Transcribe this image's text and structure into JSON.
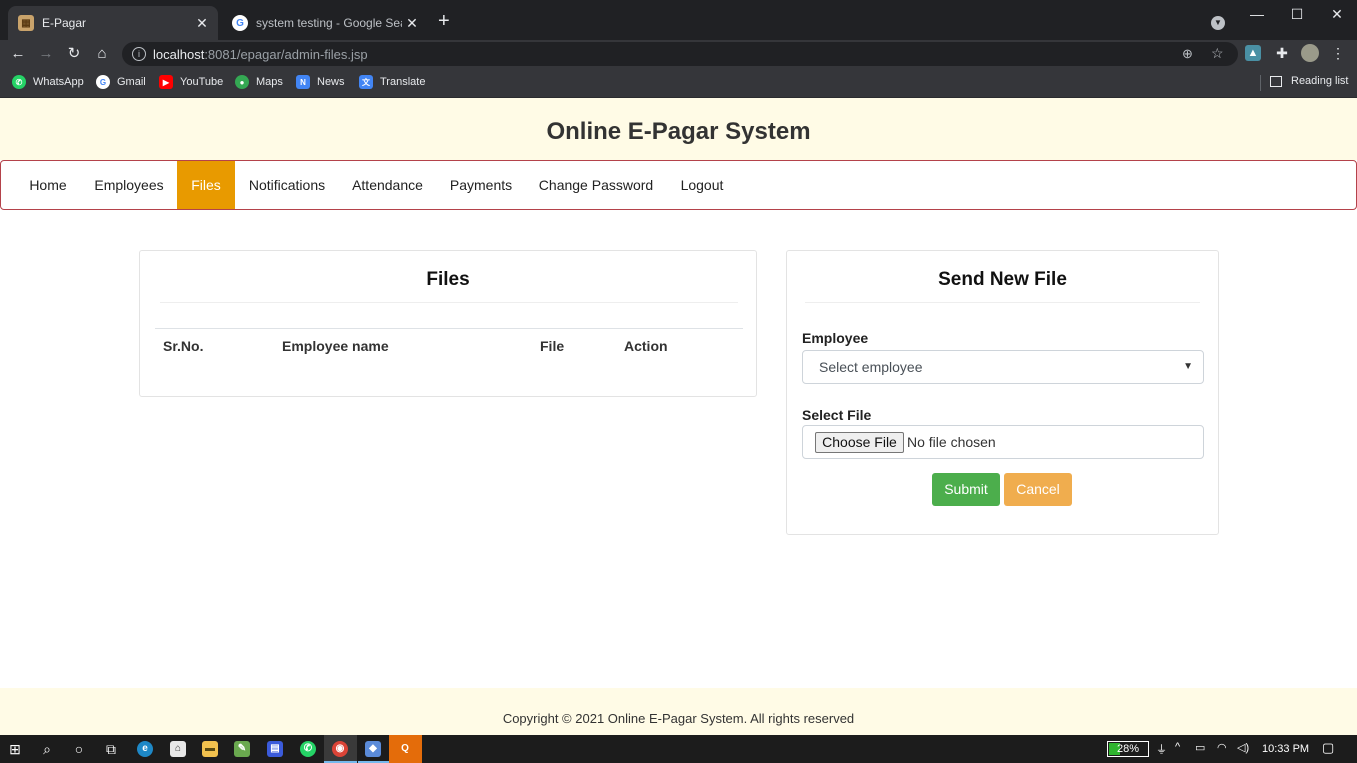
{
  "browser": {
    "tabs": [
      {
        "title": "E-Pagar",
        "active": true
      },
      {
        "title": "system testing - Google Search",
        "active": false
      }
    ],
    "url": {
      "host": "localhost",
      "path": ":8081/epagar/admin-files.jsp"
    },
    "bookmarks": [
      {
        "label": "WhatsApp",
        "icon": "whatsapp-icon",
        "color": "#25d366"
      },
      {
        "label": "Gmail",
        "icon": "google-icon",
        "color": "#ffffff"
      },
      {
        "label": "YouTube",
        "icon": "youtube-icon",
        "color": "#ff0000"
      },
      {
        "label": "Maps",
        "icon": "maps-icon",
        "color": "#34a853"
      },
      {
        "label": "News",
        "icon": "news-icon",
        "color": "#4285f4"
      },
      {
        "label": "Translate",
        "icon": "translate-icon",
        "color": "#4285f4"
      }
    ],
    "reading_list": "Reading list"
  },
  "site": {
    "title": "Online E-Pagar System",
    "nav": [
      {
        "label": "Home",
        "active": false
      },
      {
        "label": "Employees",
        "active": false
      },
      {
        "label": "Files",
        "active": true
      },
      {
        "label": "Notifications",
        "active": false
      },
      {
        "label": "Attendance",
        "active": false
      },
      {
        "label": "Payments",
        "active": false
      },
      {
        "label": "Change Password",
        "active": false
      },
      {
        "label": "Logout",
        "active": false
      }
    ],
    "accent_color": "#e89a00",
    "header_bg": "#fffbe6"
  },
  "files_card": {
    "title": "Files",
    "columns": [
      "Sr.No.",
      "Employee name",
      "File",
      "Action"
    ],
    "rows": []
  },
  "send_card": {
    "title": "Send New File",
    "employee_label": "Employee",
    "employee_select": "Select employee",
    "file_label": "Select File",
    "choose_button": "Choose File",
    "no_file": "No file chosen",
    "submit": "Submit",
    "cancel": "Cancel",
    "submit_color": "#4cae4c",
    "cancel_color": "#f0ad4e"
  },
  "footer": {
    "text": "Copyright © 2021 Online E-Pagar System. All rights reserved"
  },
  "taskbar": {
    "battery": "28%",
    "battery_level": 0.28,
    "time": "10:33 PM"
  }
}
